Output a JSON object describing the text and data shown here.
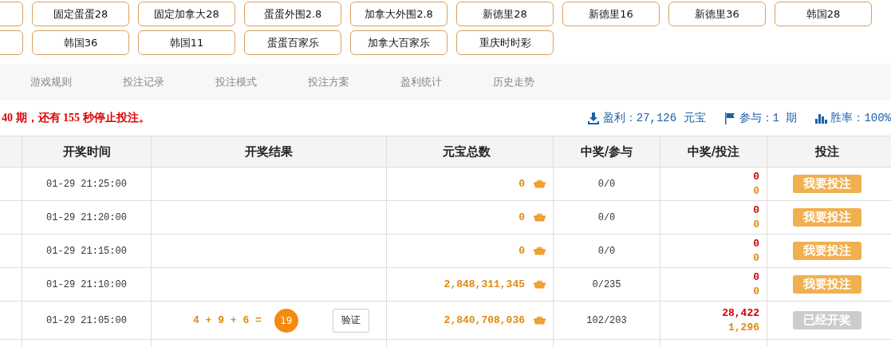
{
  "game_buttons": [
    [
      "固定蛋蛋28",
      "固定加拿大28",
      "蛋蛋外围2.8",
      "加拿大外围2.8",
      "新德里28",
      "新德里16",
      "新德里36",
      "韩国28"
    ],
    [
      "韩国36",
      "韩国11",
      "蛋蛋百家乐",
      "加拿大百家乐",
      "重庆时时彩"
    ]
  ],
  "nav": {
    "items": [
      "游戏规则",
      "投注记录",
      "投注模式",
      "投注方案",
      "盈利统计",
      "历史走势"
    ]
  },
  "notice": "40 期，还有 155 秒停止投注。",
  "stats": [
    {
      "kind": "profit",
      "text": "盈利：27,126 元宝"
    },
    {
      "kind": "participate",
      "text": "参与：1 期"
    },
    {
      "kind": "winrate",
      "text": "胜率：100%"
    }
  ],
  "table": {
    "columns": [
      "开奖时间",
      "开奖结果",
      "元宝总数",
      "中奖/参与",
      "中奖/投注",
      "投注"
    ],
    "rows": [
      {
        "time": "01-29 21:25:00",
        "total": "0",
        "win_join": "0/0",
        "win": "0",
        "bet": "0",
        "action": {
          "label": "我要投注",
          "kind": "open"
        }
      },
      {
        "time": "01-29 21:20:00",
        "total": "0",
        "win_join": "0/0",
        "win": "0",
        "bet": "0",
        "action": {
          "label": "我要投注",
          "kind": "open"
        }
      },
      {
        "time": "01-29 21:15:00",
        "total": "0",
        "win_join": "0/0",
        "win": "0",
        "bet": "0",
        "action": {
          "label": "我要投注",
          "kind": "open"
        }
      },
      {
        "time": "01-29 21:10:00",
        "total": "2,848,311,345",
        "win_join": "0/235",
        "win": "0",
        "bet": "0",
        "action": {
          "label": "我要投注",
          "kind": "open"
        }
      },
      {
        "time": "01-29 21:05:00",
        "result": {
          "formula": "4 + 9 + 6 =",
          "ball": "19",
          "verify": "验证"
        },
        "total": "2,840,708,036",
        "win_join": "102/203",
        "win": "28,422",
        "bet": "1,296",
        "action": {
          "label": "已经开奖",
          "kind": "closed"
        }
      }
    ]
  }
}
